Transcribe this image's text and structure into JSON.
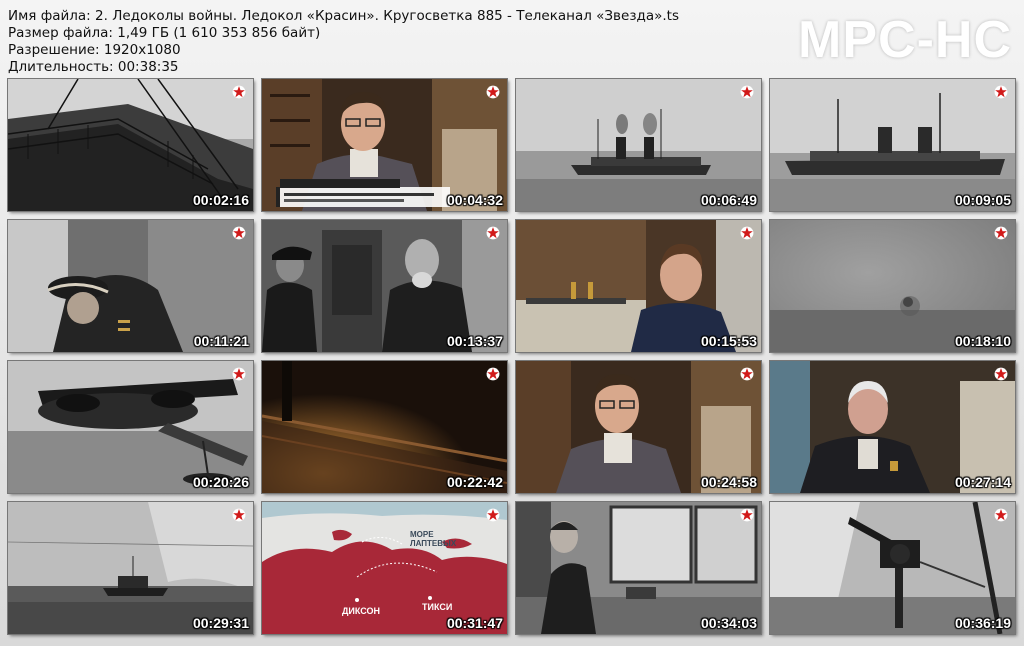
{
  "info": {
    "lines": [
      "Имя файла: 2. Ледоколы войны. Ледокол «Красин». Кругосветка 885 - Телеканал «Звезда».ts",
      "Размер файла: 1,49 ГБ (1 610 353 856 байт)",
      "Разрешение: 1920x1080",
      "Длительность: 00:38:35"
    ]
  },
  "watermark": "MPC-HC",
  "channel_logo_icon": "red-star-icon",
  "colors": {
    "logo_star": "#d11a1a",
    "timestamp": "#ffffff"
  },
  "thumbnails": [
    {
      "time": "00:02:16"
    },
    {
      "time": "00:04:32"
    },
    {
      "time": "00:06:49"
    },
    {
      "time": "00:09:05"
    },
    {
      "time": "00:11:21"
    },
    {
      "time": "00:13:37"
    },
    {
      "time": "00:15:53"
    },
    {
      "time": "00:18:10"
    },
    {
      "time": "00:20:26"
    },
    {
      "time": "00:22:42"
    },
    {
      "time": "00:24:58"
    },
    {
      "time": "00:27:14"
    },
    {
      "time": "00:29:31"
    },
    {
      "time": "00:31:47",
      "map_labels": [
        "МОРЕ ЛАПТЕВЫХ",
        "ДИКСОН",
        "ТИКСИ"
      ]
    },
    {
      "time": "00:34:03"
    },
    {
      "time": "00:36:19"
    }
  ]
}
